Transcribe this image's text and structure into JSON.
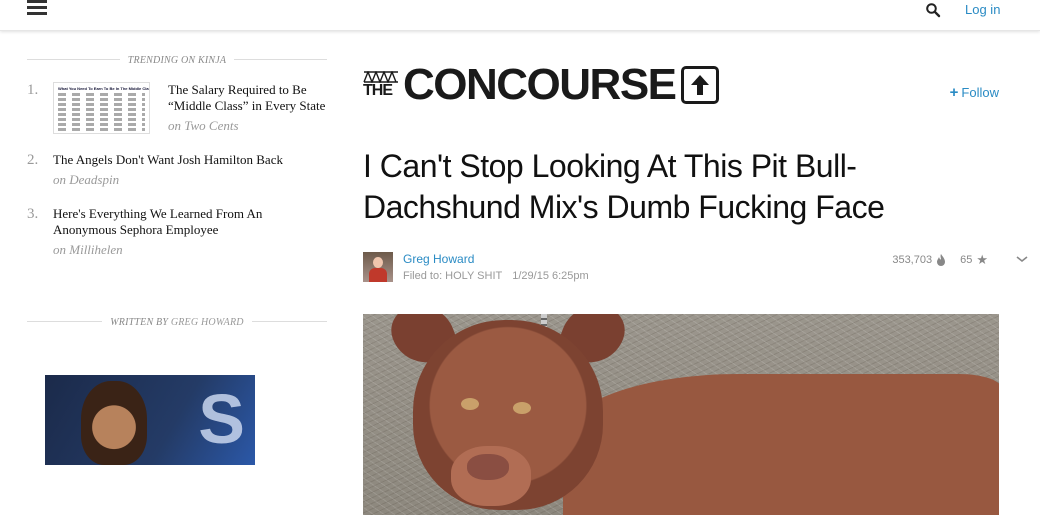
{
  "topbar": {
    "login_label": "Log in"
  },
  "sidebar": {
    "trending_heading": "TRENDING ON KINJA",
    "trending": [
      {
        "num": "1.",
        "title": "The Salary Required to Be “Middle Class” in Every State",
        "source": "on Two Cents",
        "thumb_title": "What You Need To Earn To Be In The Middle Class"
      },
      {
        "num": "2.",
        "title": "The Angels Don't Want Josh Hamilton Back",
        "source": "on Deadspin"
      },
      {
        "num": "3.",
        "title": "Here's Everything We Learned From An Anonymous Sephora Employee",
        "source": "on Millihelen"
      }
    ],
    "written_by_label": "WRITTEN BY",
    "written_by_author": "GREG HOWARD"
  },
  "main": {
    "brand_the": "THE",
    "brand_name": "CONCOURSE",
    "follow_label": "Follow",
    "headline": "I Can't Stop Looking At This Pit Bull-Dachshund Mix's Dumb Fucking Face",
    "author": "Greg Howard",
    "filed_to": "Filed to: HOLY SHIT",
    "date": "1/29/15 6:25pm",
    "views": "353,703",
    "stars": "65"
  },
  "colors": {
    "link_blue": "#2a8bc4",
    "text_dark": "#111111",
    "muted_gray": "#999999"
  }
}
